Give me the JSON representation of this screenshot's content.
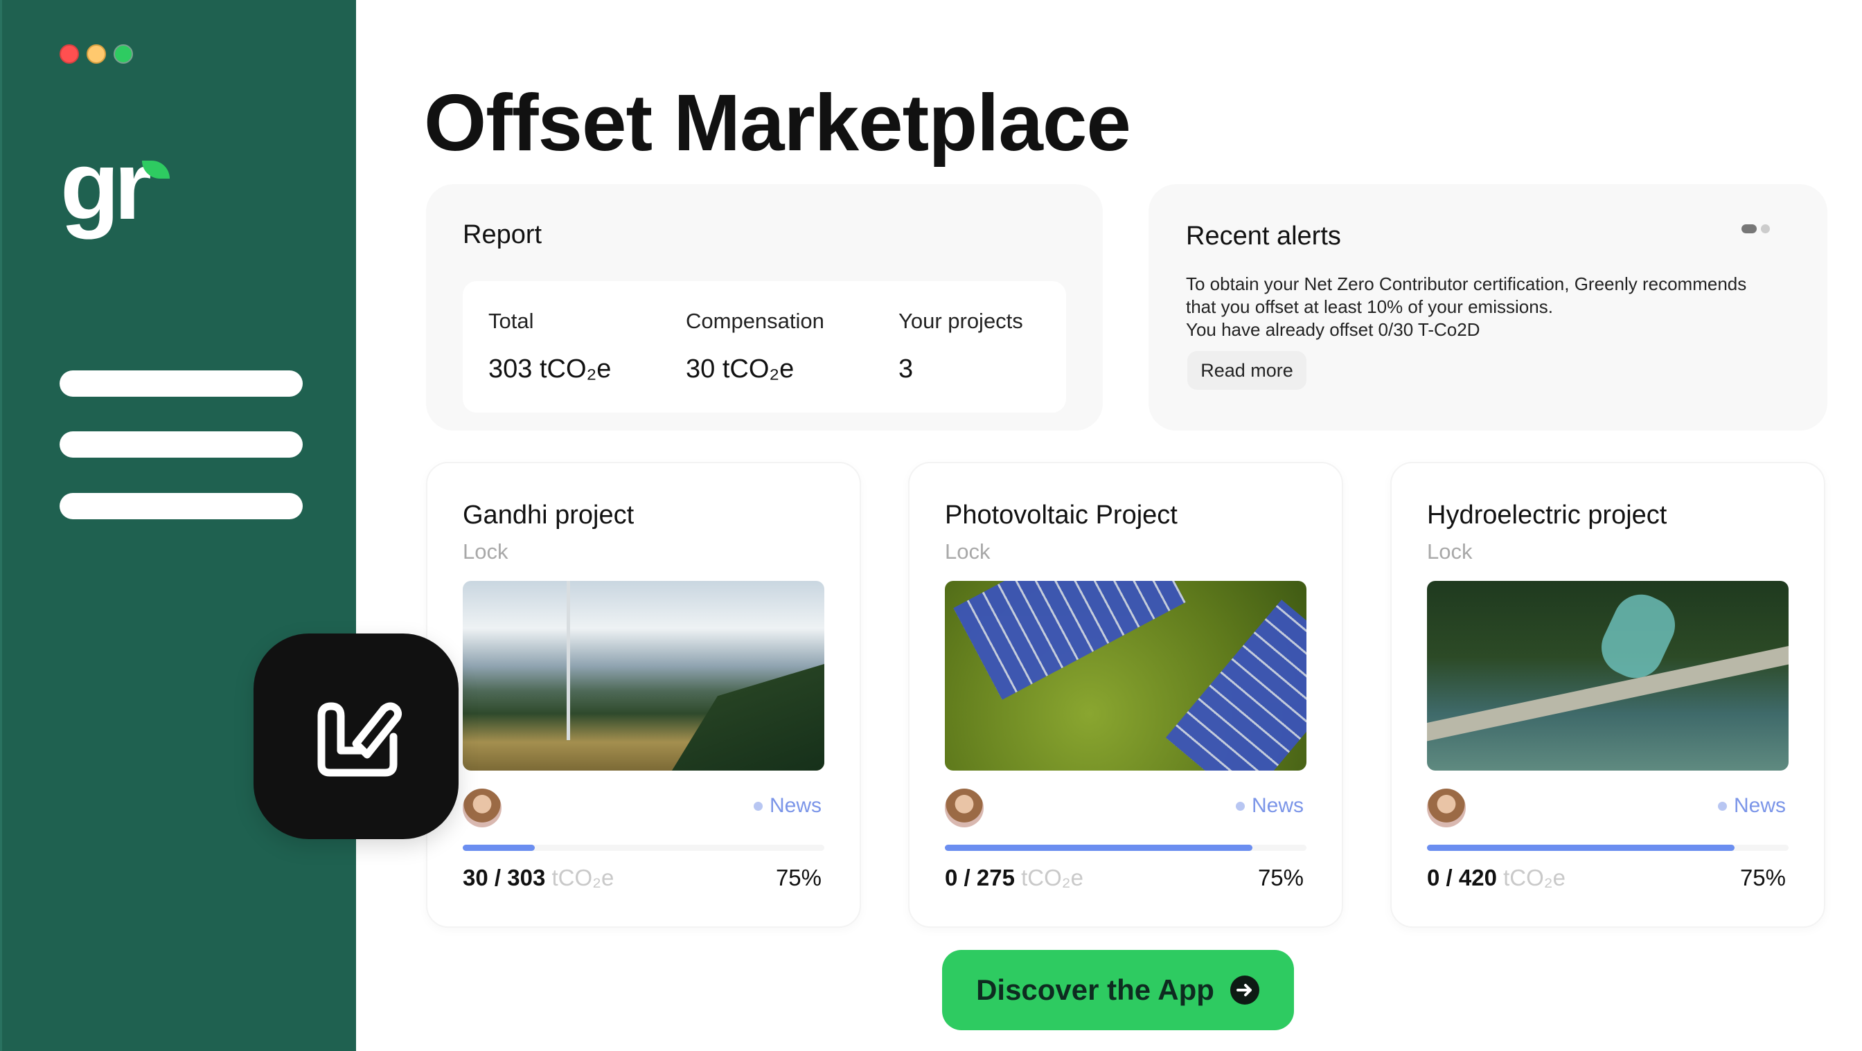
{
  "window": {
    "controls": [
      "close",
      "minimize",
      "maximize"
    ],
    "colors": {
      "close": "#ff5050",
      "minimize": "#ffc96e",
      "maximize": "#2ecb61"
    }
  },
  "sidebar": {
    "logo_text": "gr",
    "nav_items": 3,
    "bg": "#1f6150"
  },
  "page_title": "Offset Marketplace",
  "report": {
    "title": "Report",
    "stats": [
      {
        "label": "Total",
        "value": "303 tCO₂e"
      },
      {
        "label": "Compensation",
        "value": "30 tCO₂e"
      },
      {
        "label": "Your projects",
        "value": "3"
      }
    ]
  },
  "alerts": {
    "title": "Recent alerts",
    "lines": [
      "To obtain your Net Zero Contributor certification, Greenly recommends",
      "that you offset at least 10% of your emissions.",
      "You have already offset 0/30 T-Co2D"
    ],
    "read_more": "Read more"
  },
  "projects": [
    {
      "title": "Gandhi project",
      "status": "Lock",
      "tag": "News",
      "current": "30",
      "total": "303",
      "unit": "tCO₂e",
      "percent": "75%",
      "progress": 0.2
    },
    {
      "title": "Photovoltaic Project",
      "status": "Lock",
      "tag": "News",
      "current": "0",
      "total": "275",
      "unit": "tCO₂e",
      "percent": "75%",
      "progress": 0.85
    },
    {
      "title": "Hydroelectric project",
      "status": "Lock",
      "tag": "News",
      "current": "0",
      "total": "420",
      "unit": "tCO₂e",
      "percent": "75%",
      "progress": 0.85
    }
  ],
  "cta": {
    "label": "Discover the App",
    "accent": "#2ecb61"
  }
}
